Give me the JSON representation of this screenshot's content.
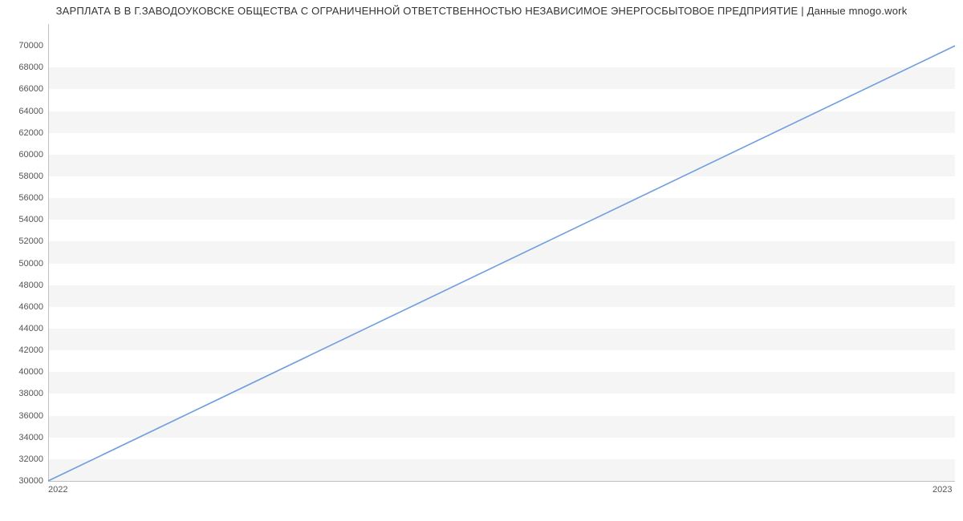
{
  "chart_data": {
    "type": "line",
    "title": "ЗАРПЛАТА В  В Г.ЗАВОДОУКОВСКЕ ОБЩЕСТВА С ОГРАНИЧЕННОЙ ОТВЕТСТВЕННОСТЬЮ НЕЗАВИСИМОЕ ЭНЕРГОСБЫТОВОЕ ПРЕДПРИЯТИЕ | Данные mnogo.work",
    "x": [
      2022,
      2023
    ],
    "series": [
      {
        "name": "salary",
        "values": [
          30000,
          70000
        ],
        "color": "#6f9ddf"
      }
    ],
    "xlabel": "",
    "ylabel": "",
    "ylim": [
      30000,
      72000
    ],
    "y_ticks": [
      30000,
      32000,
      34000,
      36000,
      38000,
      40000,
      42000,
      44000,
      46000,
      48000,
      50000,
      52000,
      54000,
      56000,
      58000,
      60000,
      62000,
      64000,
      66000,
      68000,
      70000
    ],
    "x_ticks": [
      2022,
      2023
    ],
    "grid": true
  }
}
